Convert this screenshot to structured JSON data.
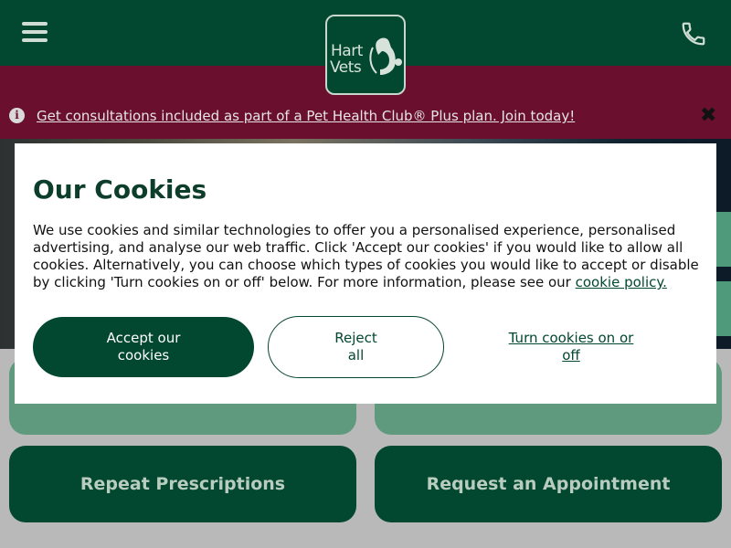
{
  "header": {
    "logo": {
      "line1": "Hart",
      "line2": "Vets"
    }
  },
  "banner": {
    "promo_text": "Get consultations included as part of a Pet Health Club® Plus plan. Join today!",
    "info_icon": "i",
    "close_symbol": "✖"
  },
  "tiles": [
    {
      "label": ""
    },
    {
      "label": ""
    },
    {
      "label": "Repeat Prescriptions"
    },
    {
      "label": "Request an Appointment"
    }
  ],
  "cookies": {
    "title": "Our Cookies",
    "body": "We use cookies and similar technologies to offer you a personalised experience, personalised advertising, and analyse our web traffic. Click 'Accept our cookies' if you would like to allow all cookies. Alternatively, you can choose which types of cookies you would like to accept or disable by clicking 'Turn cookies on or off' below. For more information, please see our ",
    "policy_link": "cookie policy.",
    "accept_label": "Accept our cookies",
    "reject_label": "Reject all",
    "turn_label": "Turn cookies on or off"
  },
  "icons": [
    "hamburger-menu-icon",
    "phone-icon",
    "info-icon",
    "close-icon",
    "dog-logo-icon"
  ],
  "colors": {
    "brand_green": "#02472f",
    "banner_maroon": "#6a0f2d",
    "tile_light_green": "#5f9a7e",
    "tile_text": "#b8cdbf"
  }
}
